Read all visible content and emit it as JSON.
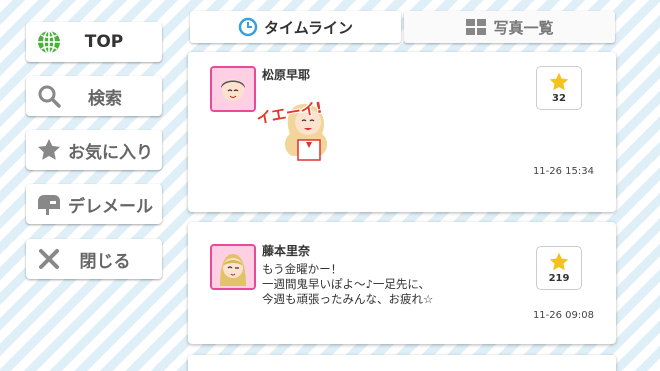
{
  "nav": {
    "top_label": "TOP",
    "search_label": "検索",
    "favorites_label": "お気に入り",
    "deremail_label": "デレメール",
    "close_label": "閉じる"
  },
  "tabs": {
    "timeline_label": "タイムライン",
    "photos_label": "写真一覧"
  },
  "posts": [
    {
      "author": "松原早耶",
      "stamp_text": "イエーイ!",
      "likes": "32",
      "timestamp": "11-26 15:34"
    },
    {
      "author": "藤本里奈",
      "message_lines": [
        "もう金曜かー！",
        "一週間鬼早いぽよ〜♪一足先に、",
        "今週も頑張ったみんな、お疲れ☆"
      ],
      "likes": "219",
      "timestamp": "11-26 09:08"
    }
  ],
  "colors": {
    "accent_pink": "#e84a9a",
    "star": "#f3c21b",
    "globe": "#4cae3c",
    "clock": "#3aa0d8"
  }
}
